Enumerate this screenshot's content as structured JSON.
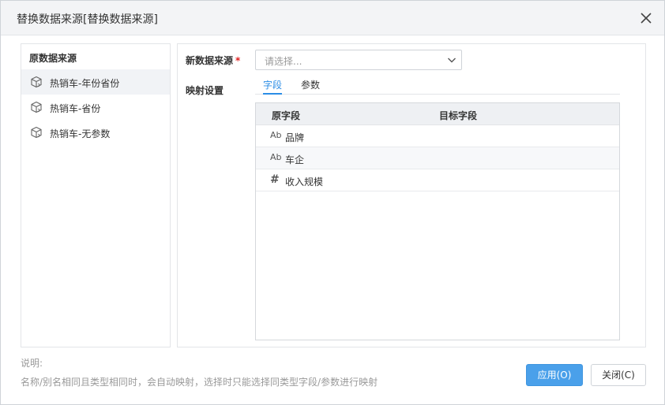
{
  "dialog": {
    "title": "替换数据来源[替换数据来源]"
  },
  "source_panel": {
    "header": "原数据来源",
    "items": [
      {
        "label": "热销车-年份省份",
        "selected": true
      },
      {
        "label": "热销车-省份",
        "selected": false
      },
      {
        "label": "热销车-无参数",
        "selected": false
      }
    ]
  },
  "form": {
    "new_source_label": "新数据来源",
    "required_mark": "*",
    "select_placeholder": "请选择...",
    "mapping_label": "映射设置",
    "tabs": [
      {
        "label": "字段",
        "active": true
      },
      {
        "label": "参数",
        "active": false
      }
    ]
  },
  "mapping_table": {
    "headers": [
      "原字段",
      "目标字段"
    ],
    "rows": [
      {
        "type_icon": "text-type-icon",
        "glyph": "Ab",
        "name": "品牌",
        "target": ""
      },
      {
        "type_icon": "text-type-icon",
        "glyph": "Ab",
        "name": "车企",
        "target": ""
      },
      {
        "type_icon": "number-type-icon",
        "glyph": "#",
        "name": "收入规模",
        "target": ""
      }
    ]
  },
  "note": {
    "title": "说明:",
    "text": "名称/别名相同且类型相同时，会自动映射，选择时只能选择同类型字段/参数进行映射"
  },
  "buttons": {
    "apply": "应用(O)",
    "close": "关闭(C)"
  },
  "colors": {
    "primary": "#4aa0ea",
    "tab_active": "#2b8de6",
    "required": "#e02020"
  }
}
